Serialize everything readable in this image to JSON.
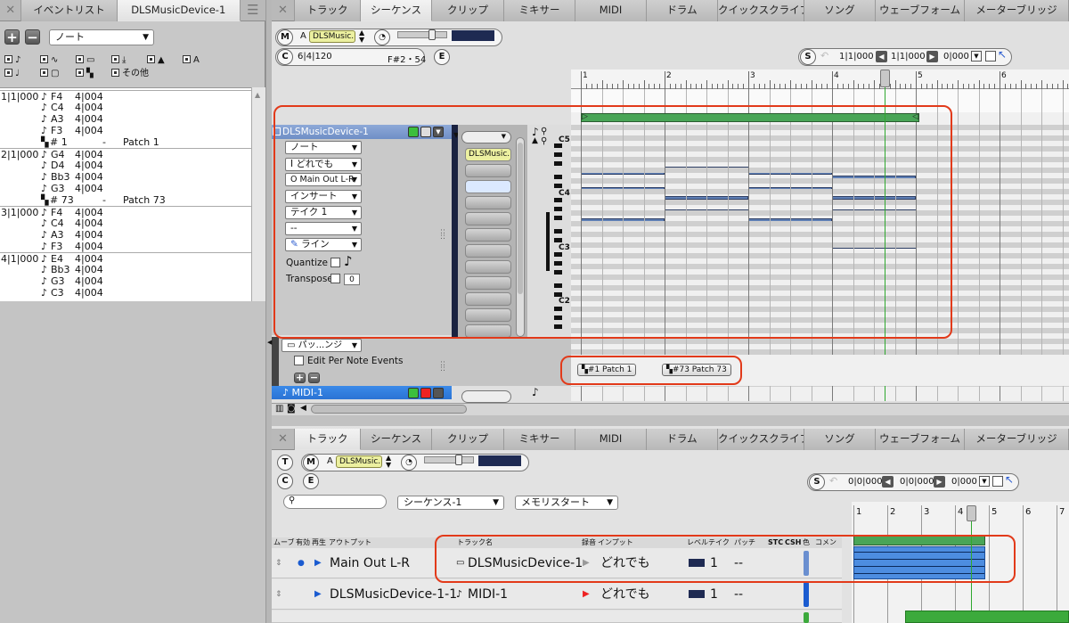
{
  "event_list_window": {
    "tabs": [
      "イベントリスト",
      "DLSMusicDevice-1"
    ],
    "type_select": "ノート",
    "filters": [
      "",
      "",
      "",
      "",
      "",
      "",
      "",
      "",
      "",
      "",
      "",
      "その他"
    ],
    "events": [
      {
        "pos": "1|1|000",
        "note": "F4",
        "dur": "4|004",
        "extra": ""
      },
      {
        "pos": "",
        "note": "C4",
        "dur": "4|004",
        "extra": ""
      },
      {
        "pos": "",
        "note": "A3",
        "dur": "4|004",
        "extra": ""
      },
      {
        "pos": "",
        "note": "F3",
        "dur": "4|004",
        "extra": ""
      },
      {
        "pos": "",
        "note": "# 1",
        "dur": "-",
        "extra": "Patch 1"
      },
      {
        "pos": "2|1|000",
        "note": "G4",
        "dur": "4|004",
        "extra": ""
      },
      {
        "pos": "",
        "note": "D4",
        "dur": "4|004",
        "extra": ""
      },
      {
        "pos": "",
        "note": "Bb3",
        "dur": "4|004",
        "extra": ""
      },
      {
        "pos": "",
        "note": "G3",
        "dur": "4|004",
        "extra": ""
      },
      {
        "pos": "",
        "note": "# 73",
        "dur": "-",
        "extra": "Patch 73"
      },
      {
        "pos": "3|1|000",
        "note": "F4",
        "dur": "4|004",
        "extra": ""
      },
      {
        "pos": "",
        "note": "C4",
        "dur": "4|004",
        "extra": ""
      },
      {
        "pos": "",
        "note": "A3",
        "dur": "4|004",
        "extra": ""
      },
      {
        "pos": "",
        "note": "F3",
        "dur": "4|004",
        "extra": ""
      },
      {
        "pos": "4|1|000",
        "note": "E4",
        "dur": "4|004",
        "extra": ""
      },
      {
        "pos": "",
        "note": "Bb3",
        "dur": "4|004",
        "extra": ""
      },
      {
        "pos": "",
        "note": "G3",
        "dur": "4|004",
        "extra": ""
      },
      {
        "pos": "",
        "note": "C3",
        "dur": "4|004",
        "extra": ""
      }
    ]
  },
  "main_tabs": [
    "トラック",
    "シーケンス",
    "クリップ",
    "ミキサー",
    "MIDI",
    "ドラム",
    "クイックスクライブ",
    "ソング",
    "ウェーブフォーム",
    "メーターブリッジ"
  ],
  "top": {
    "m_label": "M",
    "a_label": "A",
    "instrument": "DLSMusic...",
    "c_label": "C",
    "counter": "6|4|120",
    "pitch": "F#2・54",
    "e_label": "E",
    "s_label": "S",
    "loop_start": "1|1|000",
    "loop_end": "1|1|000",
    "loop_len": "0|000",
    "ruler": [
      "1",
      "2",
      "3",
      "4",
      "5",
      "6"
    ]
  },
  "track_panel": {
    "name": "DLSMusicDevice-1",
    "type": "ノート",
    "input": "どれでも",
    "output": "Main Out L-R",
    "mode": "インサート",
    "take": "テイク 1",
    "dash": "--",
    "line": "ライン",
    "quantize": "Quantize",
    "transpose": "Transpose",
    "transpose_val": "0",
    "slot_label": "DLSMusic...",
    "octaves": [
      "C5",
      "C4",
      "C3",
      "C2"
    ],
    "patch_sel": "パッ...ンジ",
    "edit_per_note": "Edit Per Note Events",
    "midi_track": "MIDI-1"
  },
  "patches": [
    "#1  Patch 1",
    "#73  Patch 73"
  ],
  "bottom": {
    "t_label": "T",
    "m_label": "M",
    "a_label": "A",
    "instrument": "DLSMusic...",
    "c_label": "C",
    "e_label": "E",
    "seq_select": "シーケンス-1",
    "mem_select": "メモリスタート",
    "s_label": "S",
    "loop_start": "0|0|000",
    "loop_end": "0|0|000",
    "loop_len": "0|000",
    "ruler": [
      "1",
      "2",
      "3",
      "4",
      "5",
      "6",
      "7"
    ],
    "col_headers": [
      "ムーブ",
      "有効",
      "再生",
      "アウトプット",
      "トラック名",
      "録音",
      "インプット",
      "レベル",
      "テイク",
      "パッチ",
      "STC",
      "CSH",
      "色",
      "コメント"
    ],
    "rows": [
      {
        "output": "Main Out L-R",
        "name": "DLSMusicDevice-1",
        "input": "どれでも",
        "take": "1",
        "patch": "--"
      },
      {
        "output": "DLSMusicDevice-1-1",
        "name": "MIDI-1",
        "input": "どれでも",
        "take": "1",
        "patch": "--"
      }
    ]
  },
  "colors": {
    "accent": "#e23a1a",
    "track_green": "#49a557",
    "note_blue": "#5e7fb5",
    "selected_track": "#2a73d4"
  }
}
